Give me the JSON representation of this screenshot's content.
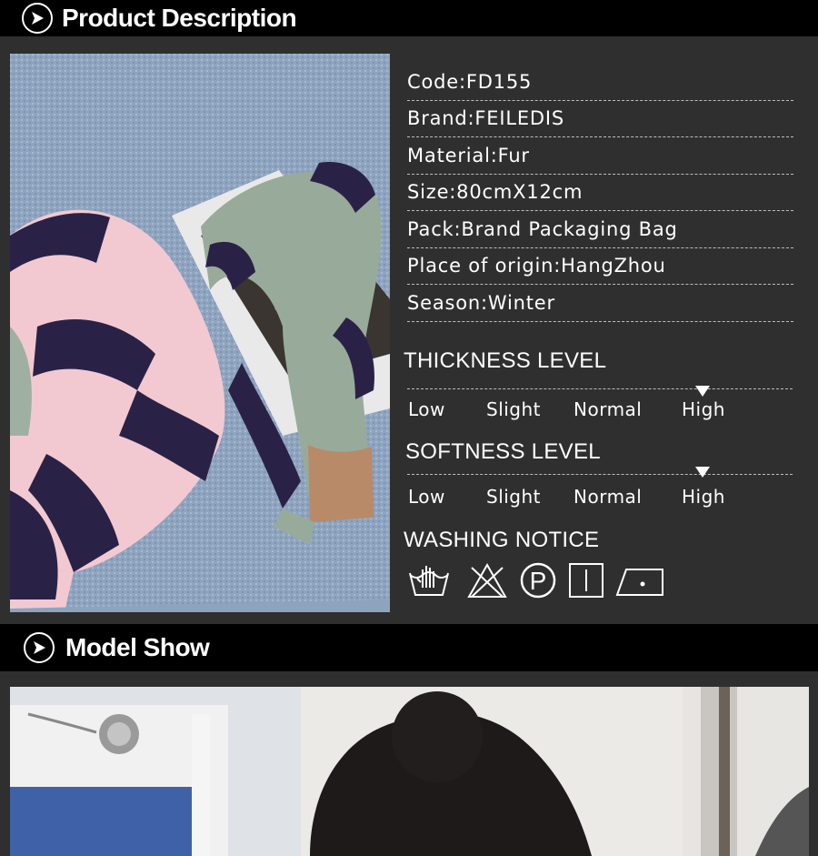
{
  "product_header": {
    "title": "Product Description"
  },
  "specs": [
    "Code:FD155",
    "Brand:FEILEDIS",
    "Material:Fur",
    "Size:80cmX12cm",
    "Pack:Brand Packaging Bag",
    "Place of origin:HangZhou",
    "Season:Winter"
  ],
  "thickness": {
    "title": "THICKNESS LEVEL",
    "labels": [
      "Low",
      "Slight",
      "Normal",
      "High"
    ],
    "selected": "High"
  },
  "softness": {
    "title": "SOFTNESS LEVEL",
    "labels": [
      "Low",
      "Slight",
      "Normal",
      "High"
    ],
    "selected": "High"
  },
  "washing": {
    "title": "WASHING NOTICE",
    "icons": [
      "hand-wash-icon",
      "no-bleach-icon",
      "dry-clean-p-icon",
      "line-dry-icon",
      "low-iron-icon"
    ]
  },
  "model_header": {
    "title": "Model Show"
  },
  "colors": {
    "background": "#2f2f2f",
    "header": "#000000",
    "text": "#ffffff",
    "divider": "#bdbdbd"
  }
}
